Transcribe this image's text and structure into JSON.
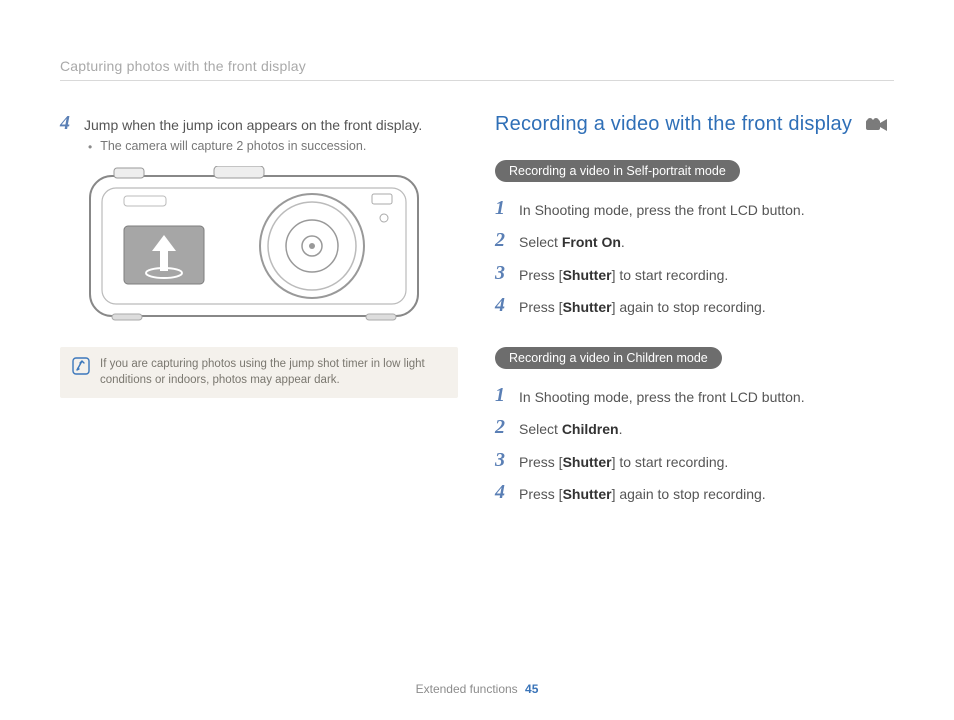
{
  "header": {
    "title": "Capturing photos with the front display"
  },
  "left": {
    "step4": {
      "num": "4",
      "text": "Jump when the jump icon appears on the front display.",
      "bullet": "The camera will capture 2 photos in succession."
    },
    "note": {
      "text": "If you are capturing photos using the jump shot timer in low light conditions or indoors, photos may appear dark."
    }
  },
  "right": {
    "title": "Recording a video with the front display",
    "section1": {
      "pill": "Recording a video in Self-portrait mode",
      "steps": [
        {
          "num": "1",
          "pre": "In Shooting mode, press the front LCD button.",
          "bold": "",
          "post": ""
        },
        {
          "num": "2",
          "pre": "Select ",
          "bold": "Front On",
          "post": "."
        },
        {
          "num": "3",
          "pre": "Press [",
          "bold": "Shutter",
          "post": "] to start recording."
        },
        {
          "num": "4",
          "pre": "Press [",
          "bold": "Shutter",
          "post": "] again to stop recording."
        }
      ]
    },
    "section2": {
      "pill": "Recording a video in Children mode",
      "steps": [
        {
          "num": "1",
          "pre": "In Shooting mode, press the front LCD button.",
          "bold": "",
          "post": ""
        },
        {
          "num": "2",
          "pre": "Select ",
          "bold": "Children",
          "post": "."
        },
        {
          "num": "3",
          "pre": "Press [",
          "bold": "Shutter",
          "post": "] to start recording."
        },
        {
          "num": "4",
          "pre": "Press [",
          "bold": "Shutter",
          "post": "] again to stop recording."
        }
      ]
    }
  },
  "footer": {
    "section": "Extended functions",
    "page": "45"
  }
}
